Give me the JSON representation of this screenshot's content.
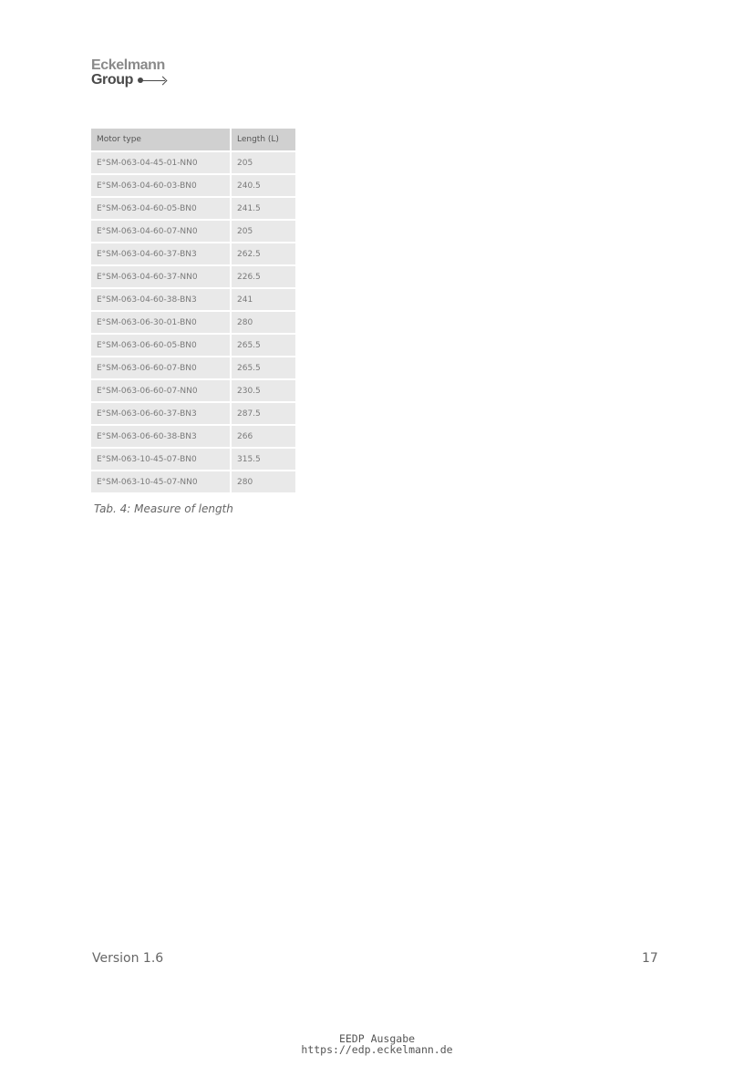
{
  "logo": {
    "line1": "Eckelmann",
    "line2": "Group"
  },
  "table": {
    "headers": [
      "Motor type",
      "Length (L)"
    ],
    "rows": [
      [
        "E°SM-063-04-45-01-NN0",
        "205"
      ],
      [
        "E°SM-063-04-60-03-BN0",
        "240.5"
      ],
      [
        "E°SM-063-04-60-05-BN0",
        "241.5"
      ],
      [
        "E°SM-063-04-60-07-NN0",
        "205"
      ],
      [
        "E°SM-063-04-60-37-BN3",
        "262.5"
      ],
      [
        "E°SM-063-04-60-37-NN0",
        "226.5"
      ],
      [
        "E°SM-063-04-60-38-BN3",
        "241"
      ],
      [
        "E°SM-063-06-30-01-BN0",
        "280"
      ],
      [
        "E°SM-063-06-60-05-BN0",
        "265.5"
      ],
      [
        "E°SM-063-06-60-07-BN0",
        "265.5"
      ],
      [
        "E°SM-063-06-60-07-NN0",
        "230.5"
      ],
      [
        "E°SM-063-06-60-37-BN3",
        "287.5"
      ],
      [
        "E°SM-063-06-60-38-BN3",
        "266"
      ],
      [
        "E°SM-063-10-45-07-BN0",
        "315.5"
      ],
      [
        "E°SM-063-10-45-07-NN0",
        "280"
      ]
    ],
    "caption": "Tab. 4: Measure of length"
  },
  "footer": {
    "version": "Version 1.6",
    "page_number": "17",
    "edition": "EEDP Ausgabe",
    "url": "https://edp.eckelmann.de"
  }
}
